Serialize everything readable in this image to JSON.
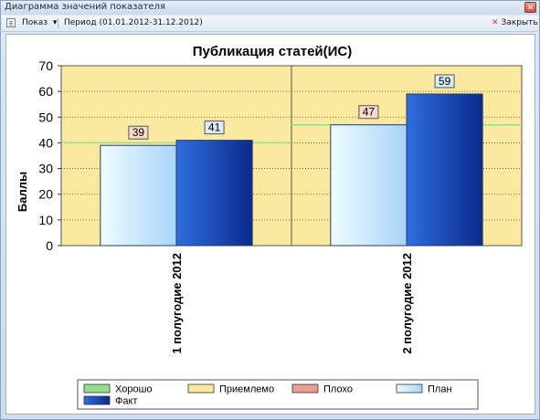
{
  "window": {
    "title": "Диаграмма значений показателя",
    "close_glyph": "✕"
  },
  "toolbar": {
    "show_label": "Показ",
    "show_arrow": "▾",
    "period_label": "Период (01.01.2012-31.12.2012)",
    "close_label": "Закрыть",
    "close_glyph": "✕"
  },
  "colors": {
    "plot_background": "#fbe9a0",
    "good": "#90e090",
    "acceptable": "#fbe9a0",
    "bad": "#e8a090",
    "plan_light": "#eefcff",
    "plan_dark": "#a8d4f8",
    "fact_light": "#2e6ee0",
    "fact_dark": "#0a2a8c"
  },
  "chart_data": {
    "type": "bar",
    "title": "Публикация статей(ИС)",
    "xlabel": "",
    "ylabel": "Баллы",
    "ylim": [
      0,
      70
    ],
    "yticks": [
      0,
      10,
      20,
      30,
      40,
      50,
      60,
      70
    ],
    "ytick_labels": [
      "0",
      "10",
      "20",
      "30",
      "40",
      "50",
      "60",
      "70"
    ],
    "categories": [
      "1 полугодие 2012",
      "2 полугодие 2012"
    ],
    "series": [
      {
        "name": "План",
        "values": [
          39,
          47
        ]
      },
      {
        "name": "Факт",
        "values": [
          41,
          59
        ]
      }
    ],
    "good_threshold": [
      40,
      47
    ],
    "grid": true,
    "legend": {
      "position": "bottom",
      "items": [
        "Хорошо",
        "Приемлемо",
        "Плохо",
        "План",
        "Факт"
      ]
    }
  }
}
